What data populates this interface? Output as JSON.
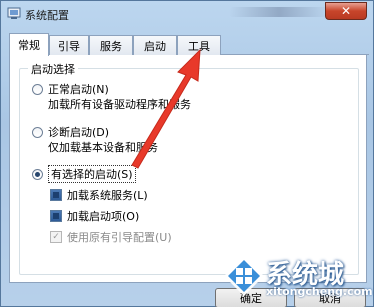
{
  "window": {
    "title": "系统配置",
    "close_label": "✕"
  },
  "tabs": [
    {
      "label": "常规",
      "active": true
    },
    {
      "label": "引导",
      "active": false
    },
    {
      "label": "服务",
      "active": false
    },
    {
      "label": "启动",
      "active": false
    },
    {
      "label": "工具",
      "active": false
    }
  ],
  "startup": {
    "group_title": "启动选择",
    "options": [
      {
        "label": "正常启动(N)",
        "description": "加载所有设备驱动程序和服务",
        "checked": false
      },
      {
        "label": "诊断启动(D)",
        "description": "仅加载基本设备和服务",
        "checked": false
      },
      {
        "label": "有选择的启动(S)",
        "checked": true
      }
    ],
    "sub_options": [
      {
        "label": "加载系统服务(L)",
        "checked": true,
        "enabled": true
      },
      {
        "label": "加载启动项(O)",
        "checked": true,
        "enabled": true
      },
      {
        "label": "使用原有引导配置(U)",
        "checked": true,
        "enabled": false
      }
    ]
  },
  "buttons": {
    "ok": "确定",
    "cancel": "取消"
  },
  "watermark": {
    "name": "系统城",
    "url": "xitongcheng.com"
  },
  "colors": {
    "arrow": "#e8392a",
    "accent": "#2d5a96"
  },
  "icons": {
    "app": "system-config-icon",
    "close": "close-icon",
    "arrow": "red-arrow-annotation"
  }
}
